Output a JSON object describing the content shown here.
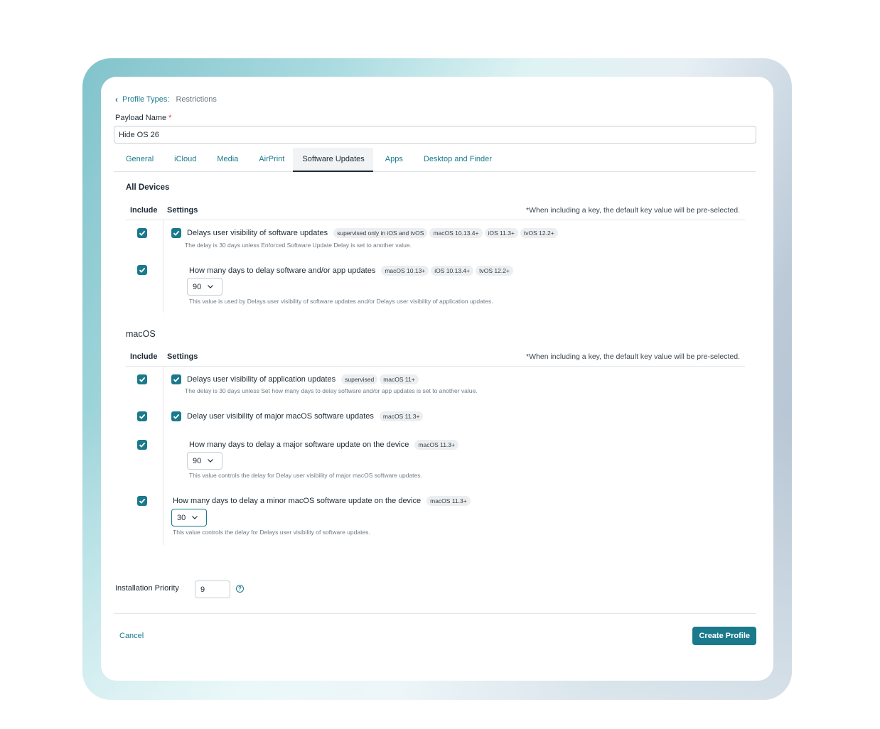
{
  "breadcrumb": {
    "link": "Profile Types:",
    "current": "Restrictions"
  },
  "payload": {
    "label": "Payload Name",
    "required_mark": "*",
    "value": "Hide OS 26"
  },
  "tabs": [
    {
      "label": "General"
    },
    {
      "label": "iCloud"
    },
    {
      "label": "Media"
    },
    {
      "label": "AirPrint"
    },
    {
      "label": "Software Updates",
      "active": true
    },
    {
      "label": "Apps"
    },
    {
      "label": "Desktop and Finder"
    }
  ],
  "all_devices": {
    "title": "All Devices",
    "col_include": "Include",
    "col_settings": "Settings",
    "note": "*When including a key, the default key value will be pre-selected.",
    "rows": [
      {
        "label": "Delays user visibility of software updates",
        "tags": [
          "supervised only in iOS and tvOS",
          "macOS 10.13.4+",
          "iOS 11.3+",
          "tvOS 12.2+"
        ],
        "desc": "The delay is 30 days unless Enforced Software Update Delay is set to another value."
      },
      {
        "label": "How many days to delay software and/or app updates",
        "tags": [
          "macOS 10.13+",
          "iOS 10.13.4+",
          "tvOS 12.2+"
        ],
        "select": "90",
        "desc": "This value is used by Delays user visibility of software updates and/or Delays user visibility of application updates."
      }
    ]
  },
  "macos": {
    "title": "macOS",
    "col_include": "Include",
    "col_settings": "Settings",
    "note": "*When including a key, the default key value will be pre-selected.",
    "rows": [
      {
        "label": "Delays user visibility of application updates",
        "tags": [
          "supervised",
          "macOS 11+"
        ],
        "desc": "The delay is 30 days unless Set how many days to delay software and/or app updates is set to another value."
      },
      {
        "label": "Delay user visibility of major macOS software updates",
        "tags": [
          "macOS 11.3+"
        ]
      },
      {
        "label": "How many days to delay a major software update on the device",
        "tags": [
          "macOS 11.3+"
        ],
        "select": "90",
        "desc": "This value controls the delay for Delay user visibility of major macOS software updates."
      },
      {
        "label": "How many days to delay a minor macOS software update on the device",
        "tags": [
          "macOS 11.3+"
        ],
        "select": "30",
        "desc": "This value controls the delay for Delays user visibility of software updates."
      }
    ]
  },
  "installation_priority": {
    "label": "Installation Priority",
    "value": "9",
    "help": "?"
  },
  "footer": {
    "cancel": "Cancel",
    "create": "Create Profile"
  },
  "colors": {
    "accent": "#1a7a8c",
    "text": "#1d2b36"
  },
  "icons": [
    "chevron-left-icon",
    "checkbox-checked-icon",
    "chevron-down-icon",
    "help-icon"
  ]
}
